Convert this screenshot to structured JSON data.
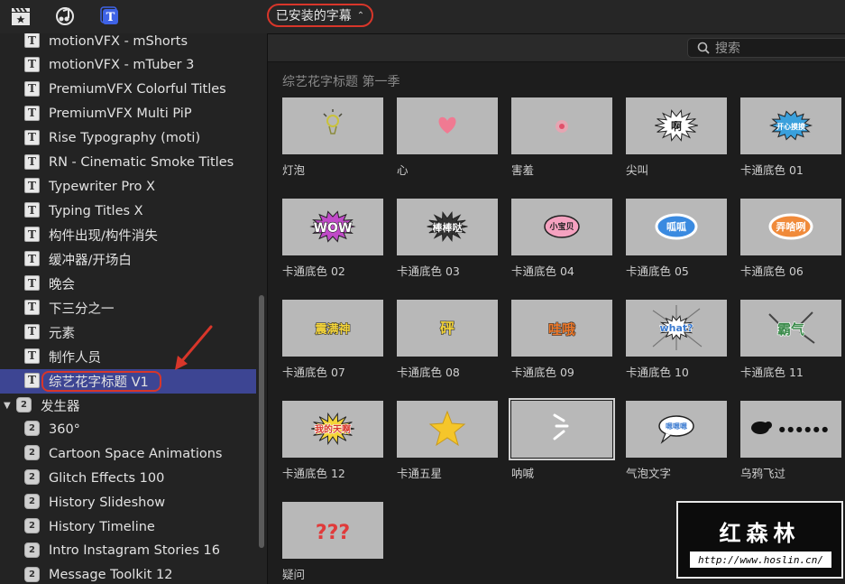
{
  "toolbar": {
    "library_dropdown": "已安装的字幕",
    "chevron": "⌃⌄"
  },
  "sidebar": {
    "items": [
      {
        "label": "motionVFX - mShorts",
        "icon": "title-icon"
      },
      {
        "label": "motionVFX - mTuber 3",
        "icon": "title-icon"
      },
      {
        "label": "PremiumVFX Colorful Titles",
        "icon": "title-icon"
      },
      {
        "label": "PremiumVFX Multi PiP",
        "icon": "title-icon"
      },
      {
        "label": "Rise Typography (moti)",
        "icon": "title-icon"
      },
      {
        "label": "RN - Cinematic Smoke Titles",
        "icon": "title-icon"
      },
      {
        "label": "Typewriter Pro X",
        "icon": "title-icon"
      },
      {
        "label": "Typing Titles X",
        "icon": "title-icon"
      },
      {
        "label": "构件出现/构件消失",
        "icon": "title-icon"
      },
      {
        "label": "缓冲器/开场白",
        "icon": "title-icon"
      },
      {
        "label": "晚会",
        "icon": "title-icon"
      },
      {
        "label": "下三分之一",
        "icon": "title-icon"
      },
      {
        "label": "元素",
        "icon": "title-icon"
      },
      {
        "label": "制作人员",
        "icon": "title-icon"
      },
      {
        "label": "综艺花字标题 V1",
        "icon": "title-icon",
        "selected": true
      },
      {
        "label": "发生器",
        "icon": "generator-icon",
        "group": true
      },
      {
        "label": "360°",
        "icon": "generator-icon"
      },
      {
        "label": "Cartoon Space Animations",
        "icon": "generator-icon"
      },
      {
        "label": "Glitch Effects 100",
        "icon": "generator-icon"
      },
      {
        "label": "History Slideshow",
        "icon": "generator-icon"
      },
      {
        "label": "History Timeline",
        "icon": "generator-icon"
      },
      {
        "label": "Intro Instagram Stories 16",
        "icon": "generator-icon"
      },
      {
        "label": "Message Toolkit 12",
        "icon": "generator-icon"
      }
    ],
    "title_glyph": "T",
    "generator_glyph": "2",
    "group_triangle": "▼"
  },
  "search": {
    "placeholder": "搜索"
  },
  "browser": {
    "section_title": "综艺花字标题 第一季",
    "tiles": [
      {
        "name": "灯泡",
        "art": "bulb"
      },
      {
        "name": "心",
        "art": "heart"
      },
      {
        "name": "害羞",
        "art": "shy"
      },
      {
        "name": "尖叫",
        "art": "scream",
        "text": "啊"
      },
      {
        "name": "卡通底色 01",
        "art": "burst-blue",
        "text": "开心摸摸"
      },
      {
        "name": "卡通底色 02",
        "art": "wow",
        "text": "WOW"
      },
      {
        "name": "卡通底色 03",
        "art": "burst-dark",
        "text": "棒棒哒"
      },
      {
        "name": "卡通底色 04",
        "art": "bubble-pink",
        "text": "小宝贝"
      },
      {
        "name": "卡通底色 05",
        "art": "cloud-blue",
        "text": "呱呱"
      },
      {
        "name": "卡通底色 06",
        "art": "cloud-orange",
        "text": "弄啥咧"
      },
      {
        "name": "卡通底色 07",
        "art": "yellow-text",
        "text": "震满神"
      },
      {
        "name": "卡通底色 08",
        "art": "yellow-text",
        "text": "砰"
      },
      {
        "name": "卡通底色 09",
        "art": "orange-text",
        "text": "哇哦"
      },
      {
        "name": "卡通底色 10",
        "art": "what",
        "text": "what?"
      },
      {
        "name": "卡通底色 11",
        "art": "green-text",
        "text": "霸气"
      },
      {
        "name": "卡通底色 12",
        "art": "comic",
        "text": "我的天啊"
      },
      {
        "name": "卡通五星",
        "art": "star"
      },
      {
        "name": "呐喊",
        "art": "shout",
        "selected": true
      },
      {
        "name": "气泡文字",
        "art": "bubble-text",
        "text": "嗯嗯嗯"
      },
      {
        "name": "乌鸦飞过",
        "art": "crow",
        "text": "● ● ● ● ● ●"
      },
      {
        "name": "疑问",
        "art": "question",
        "text": "???"
      }
    ]
  },
  "watermark": {
    "title": "红森林",
    "url": "http://www.hoslin.cn/"
  },
  "colors": {
    "accent_red": "#d8362a",
    "selection_blue": "#3d4593",
    "title_icon_blue": "#3f63e6"
  }
}
